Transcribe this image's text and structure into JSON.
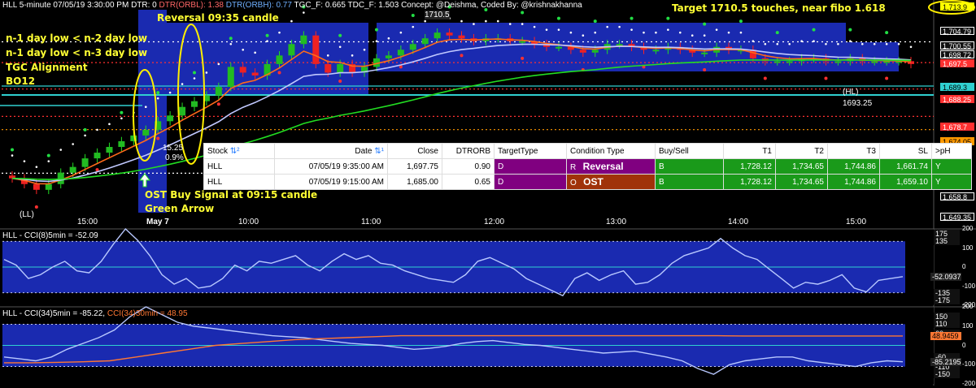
{
  "header": {
    "symbol_info": "HLL 5-minute 07/05/19 3:30:00 PM",
    "dtr": "DTR: 0",
    "dtr_orbl": "DTR(ORBL): 1.38",
    "dtr_orbh": "DTR(ORBH): 0.77",
    "tgc_f": "TGC_F: 0.665",
    "tdc_f": "TDC_F: 1.503",
    "concept": "Concept: @Deishma, Coded By: @krishnakhanna"
  },
  "annotations": {
    "reversal": "Reversal 09:35 candle",
    "target": "Target 1710.5 touches, near fibo 1.618",
    "conditions": [
      "n-1 day low < n-2 day low",
      "n-1 day low < n-3 day low",
      "TGC Alignment",
      "BO12"
    ],
    "ost_signal": "OST Buy Signal at 09:15 candle",
    "green_arrow": "Green Arrow",
    "high_label": "1710.5",
    "hl_label": "(HL)",
    "hl_value": "1693.25",
    "ll_label": "(LL)",
    "pct_label": "15.25",
    "pct2_label": "0.9%"
  },
  "price_labels": [
    {
      "text": "1,713.9",
      "color": "#ffff00"
    },
    {
      "text": "1,704.79",
      "color": "#ffffff"
    },
    {
      "text": "1,700.55",
      "color": "#ffffff"
    },
    {
      "text": "1,698.72",
      "color": "#ffffff"
    },
    {
      "text": "1,697.5",
      "color": "#ff3030"
    },
    {
      "text": "1,689.3",
      "color": "#30d0d0"
    },
    {
      "text": "1,688.25",
      "color": "#ff3030"
    },
    {
      "text": "1,678.7",
      "color": "#ff3030"
    },
    {
      "text": "1,674.05",
      "color": "#ff9900"
    },
    {
      "text": "1,658.8",
      "color": "#ffffff"
    },
    {
      "text": "1,649.35",
      "color": "#ffffff"
    }
  ],
  "time_axis": [
    "15:00",
    "May 7",
    "10:00",
    "11:00",
    "12:00",
    "13:00",
    "14:00",
    "15:00"
  ],
  "table": {
    "headers": [
      "Stock",
      "Date",
      "Close",
      "DTRORB",
      "TargetType",
      "Condition Type",
      "Buy/Sell",
      "T1",
      "T2",
      "T3",
      "SL",
      ">pH"
    ],
    "rows": [
      {
        "stock": "HLL",
        "date": "07/05/19 9:35:00 AM",
        "close": "1,697.75",
        "dtrorb": "0.90",
        "target_type": "D",
        "cond_code": "R",
        "cond": "Reversal",
        "bs": "B",
        "t1": "1,728.12",
        "t2": "1,734.65",
        "t3": "1,744.86",
        "sl": "1,661.74",
        "ph": "Y"
      },
      {
        "stock": "HLL",
        "date": "07/05/19 9:15:00 AM",
        "close": "1,685.00",
        "dtrorb": "0.65",
        "target_type": "D",
        "cond_code": "O",
        "cond": "OST",
        "bs": "B",
        "t1": "1,728.12",
        "t2": "1,734.65",
        "t3": "1,744.86",
        "sl": "1,659.10",
        "ph": "Y"
      }
    ]
  },
  "cci8": {
    "title": "HLL - CCI(8)5min = -52.09",
    "ticks": [
      "175",
      "135",
      "-135",
      "-175"
    ],
    "value_label": "-52.0937",
    "right_labels": [
      "200",
      "100",
      "0",
      "-100",
      "-200"
    ]
  },
  "cci34": {
    "title_a": "HLL - CCI(34)5min = -85.22,",
    "title_b": "CCI(34)30min = 48.95",
    "ticks": [
      "150",
      "110",
      "60",
      "-60",
      "-110",
      "-150"
    ],
    "value_labels": [
      "48.9459",
      "-85.2195"
    ],
    "right_labels": [
      "200",
      "100",
      "0",
      "-100",
      "-200"
    ]
  },
  "chart_data": [
    {
      "type": "candlestick",
      "title": "HLL 5-minute",
      "y_range": [
        1645,
        1716
      ],
      "key_levels": [
        1713.9,
        1704.79,
        1700.55,
        1698.72,
        1697.5,
        1689.3,
        1688.25,
        1678.7,
        1674.05,
        1658.8,
        1649.35
      ],
      "high_marker": 1710.5,
      "hl_marker": 1693.25,
      "close_series": [
        1657,
        1655,
        1653,
        1655,
        1659,
        1661,
        1664,
        1666,
        1668,
        1670,
        1672,
        1674,
        1677,
        1679,
        1682,
        1684,
        1686,
        1689,
        1696,
        1694,
        1693,
        1697,
        1700,
        1704,
        1707,
        1697,
        1694,
        1697,
        1694,
        1696,
        1699,
        1700,
        1702,
        1704,
        1706,
        1708,
        1707,
        1706,
        1705,
        1706,
        1706,
        1705,
        1705,
        1704,
        1703,
        1703,
        1702,
        1701,
        1702,
        1704,
        1704,
        1703,
        1702,
        1702,
        1703,
        1702,
        1701,
        1701,
        1703,
        1702,
        1702,
        1699,
        1698,
        1698,
        1698,
        1699,
        1699,
        1698,
        1698,
        1699,
        1698,
        1698,
        1698,
        1698,
        1697
      ]
    },
    {
      "type": "line",
      "title": "HLL - CCI(8)5min",
      "y_range": [
        -200,
        200
      ],
      "series": [
        {
          "name": "CCI(8)5min",
          "values": [
            40,
            10,
            -60,
            -40,
            0,
            30,
            -20,
            -30,
            30,
            120,
            200,
            140,
            60,
            -40,
            -90,
            -60,
            -110,
            -100,
            -60,
            10,
            -20,
            30,
            20,
            40,
            60,
            10,
            -20,
            30,
            70,
            40,
            60,
            20,
            10,
            -20,
            -40,
            -60,
            -70,
            -80,
            -40,
            30,
            50,
            20,
            -10,
            -60,
            -90,
            -120,
            -150,
            -60,
            -30,
            -70,
            -40,
            -20,
            -90,
            -80,
            -40,
            20,
            60,
            80,
            100,
            150,
            100,
            60,
            40,
            -10,
            -60,
            -110,
            -80,
            -90,
            -70,
            -40,
            -110,
            -130,
            -70,
            -60,
            -50
          ]
        }
      ]
    },
    {
      "type": "line",
      "title": "HLL - CCI(34)",
      "y_range": [
        -200,
        200
      ],
      "series": [
        {
          "name": "CCI(34)5min",
          "values": [
            -60,
            -70,
            -80,
            -60,
            -20,
            10,
            40,
            80,
            150,
            200,
            160,
            120,
            100,
            90,
            80,
            70,
            60,
            50,
            45,
            40,
            30,
            20,
            10,
            5,
            0,
            -10,
            -20,
            -15,
            -5,
            10,
            20,
            25,
            15,
            5,
            0,
            -10,
            -20,
            -30,
            -40,
            -35,
            -30,
            -45,
            -60,
            -80,
            -120,
            -150,
            -100,
            -80,
            -70,
            -60,
            -60,
            -80,
            -90,
            -100,
            -110,
            -90,
            -80,
            -85
          ]
        },
        {
          "name": "CCI(34)30min",
          "values": [
            -90,
            -90,
            -88,
            -85,
            -80,
            -60,
            -40,
            -20,
            0,
            10,
            20,
            30,
            35,
            40,
            45,
            50,
            50,
            50,
            50,
            50,
            50,
            50,
            50,
            50,
            50,
            50,
            50,
            50,
            49,
            49,
            49,
            49,
            49,
            49,
            49
          ]
        }
      ]
    }
  ]
}
